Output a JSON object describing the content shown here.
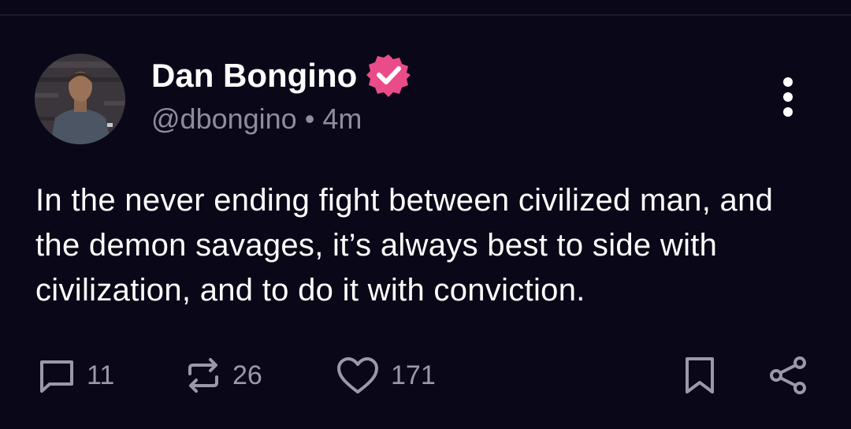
{
  "post": {
    "author_name": "Dan Bongino",
    "handle": "@dbongino",
    "separator": "•",
    "time_ago": "4m",
    "verified": true,
    "text": "In the never ending fight between civilized man, and the demon savages, it’s always best to side with civilization, and to do it with conviction."
  },
  "actions": {
    "reply_count": "11",
    "repost_count": "26",
    "like_count": "171"
  },
  "icons": {
    "verified": "verified-badge-icon",
    "more": "more-vertical-icon",
    "reply": "comment-icon",
    "repost": "repost-icon",
    "like": "heart-icon",
    "bookmark": "bookmark-icon",
    "share": "share-icon"
  },
  "colors": {
    "background": "#0a0818",
    "verified_badge": "#ea4c89",
    "secondary_text": "#8e8c9e"
  }
}
